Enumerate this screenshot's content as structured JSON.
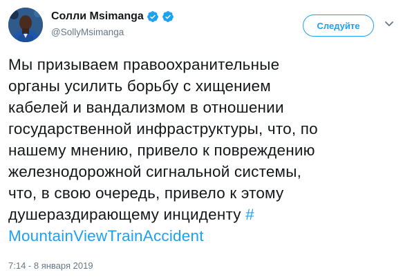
{
  "author": {
    "display_name": "Солли Msimanga",
    "handle": "@SollyMsimanga",
    "verified_badges": [
      "verified-icon",
      "verified-icon"
    ]
  },
  "follow_button": {
    "label": "Следуйте"
  },
  "tweet": {
    "lines": [
      "Мы призываем правоохранительные",
      "органы усилить борьбу с хищением",
      "кабелей и вандализмом в отношении",
      "государственной инфраструктуры, что, по",
      "нашему мнению, привело к повреждению",
      "железнодорожной сигнальной системы,",
      "что, в свою очередь, привело к этому",
      "душераздирающему инциденту"
    ],
    "hashtag_symbol": "#",
    "hashtag_text": "MountainViewTrainAccident",
    "timestamp": "7:14 - 8 января 2019"
  },
  "colors": {
    "accent": "#1da1f2",
    "text": "#14171a",
    "secondary_text": "#657786"
  }
}
